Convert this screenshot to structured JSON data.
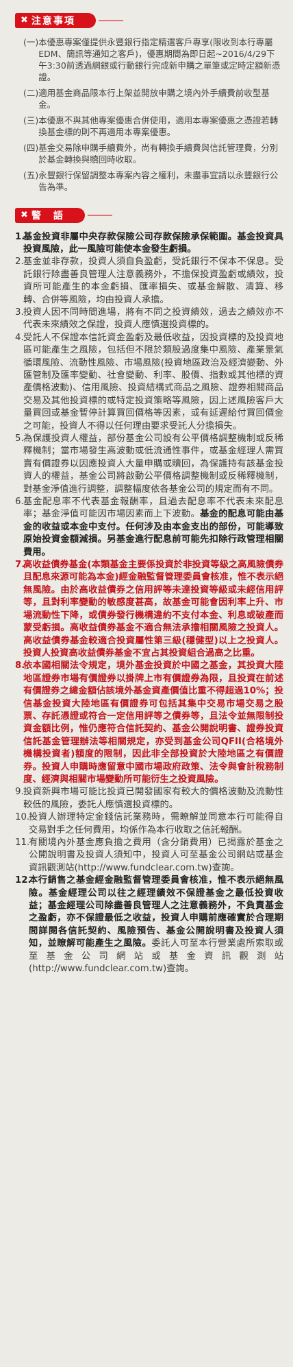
{
  "notes_heading": {
    "icon": "x-mark-icon",
    "label": "注意事項"
  },
  "notes": [
    {
      "num": "(一)",
      "text": "本優惠專案僅提供永豐銀行指定精選客戶專享(限收到本行專屬EDM、簡訊等通知之客戶)，優惠期間為即日起~2016/4/29下午3:30前透過網銀或行動銀行完成新申購之單筆或定時定額新憑證。"
    },
    {
      "num": "(二)",
      "text": "適用基金商品限本行上架並開放申購之境內外手續費前收型基金。"
    },
    {
      "num": "(三)",
      "text": "本優惠不與其他專案優惠合併使用，適用本專案優惠之憑證若轉換基金標的則不再適用本專案優惠。"
    },
    {
      "num": "(四)",
      "text": "基金交易除申購手續費外，尚有轉換手續費與信託管理費，分別於基金轉換與贖回時收取。"
    },
    {
      "num": "(五)",
      "text": "永豐銀行保留調整本專案內容之權利，未盡事宜請以永豐銀行公告為準。"
    }
  ],
  "warnings_heading": {
    "icon": "x-mark-icon",
    "label": "警　語"
  },
  "warnings": [
    {
      "num": "1.",
      "segments": [
        {
          "t": "基金投資非屬中央存款保險公司存款保險承保範圍。基金投資具投資風險，此一風險可能使本金發生虧損。",
          "s": "b"
        }
      ]
    },
    {
      "num": "2.",
      "segments": [
        {
          "t": "基金並非存款，投資人須自負盈虧，受託銀行不保本不保息。受託銀行除盡善良管理人注意義務外，不擔保投資盈虧或績效，投資所可能產生的本金虧損、匯率損失、或基金解散、清算、移轉、合併等風險，均由投資人承擔。",
          "s": ""
        }
      ]
    },
    {
      "num": "3.",
      "segments": [
        {
          "t": "投資人因不同時間進場，將有不同之投資績效，過去之績效亦不代表未來績效之保證，投資人應慎選投資標的。",
          "s": ""
        }
      ]
    },
    {
      "num": "4.",
      "segments": [
        {
          "t": "受託人不保證本信託資金盈虧及最低收益，因投資標的及投資地區可能產生之風險，包括但不限於類股過度集中風險、產業景氣循環風險、流動性風險、市場風險(投資地區政治及經濟變動、外匯管制及匯率變動、社會變動、利率、股價、指數或其他標的資產價格波動)、信用風險、投資結構式商品之風險、證券相關商品交易及其他投資標的或特定投資策略等風險，因上述風險客戶大量買回或基金暫停計算買回價格等因素，或有延遲給付買回價金之可能，投資人不得以任何理由要求受託人分擔損失。",
          "s": ""
        }
      ]
    },
    {
      "num": "5.",
      "segments": [
        {
          "t": "為保護投資人權益，部份基金公司設有公平價格調整機制或反稀釋機制；當市場發生高波動或低流通性事件，或基金經理人需買賣有價證券以因應投資人大量申購或贖回，為保護持有該基金投資人的權益，基金公司將啟動公平價格調整機制或反稀釋機制，對基金淨值進行調整，調整幅度依各基金公司的規定而有不同。",
          "s": ""
        }
      ]
    },
    {
      "num": "6.",
      "segments": [
        {
          "t": "基金配息率不代表基金報酬率，且過去配息率不代表未來配息率；基金淨值可能因市場因素而上下波動。",
          "s": ""
        },
        {
          "t": "基金的配息可能由基金的收益或本金中支付。任何涉及由本金支出的部份，可能導致原始投資金額減損。另基金進行配息前可能先扣除行政管理相關費用。",
          "s": "b"
        }
      ]
    },
    {
      "num": "7.",
      "item": "red",
      "segments": [
        {
          "t": "高收益債券基金(本類基金主要係投資於非投資等級之高風險債券且配息來源可能為本金)經金融監督管理委員會核准，惟不表示絕無風險。由於高收益債券之信用評等未達投資等級或未經信用評等，且對利率變動的敏感度甚高，故基金可能會因利率上升、市場流動性下降，或債券發行機構違約不支付本金、利息或破產而蒙受虧損。高收益債券基金不適合無法承擔相關風險之投資人。高收益債券基金較適合投資屬性第三級(穩健型)以上之投資人。投資人投資高收益債券基金不宜占其投資組合過高之比重。",
          "s": "red"
        }
      ]
    },
    {
      "num": "8.",
      "item": "red",
      "segments": [
        {
          "t": "依本國相關法令規定，境外基金投資於中國之基金，其投資大陸地區證券市場有價證券以掛牌上市有價證券為限，且投資在前述有價證券之總金額佔該境外基金資產價值比重不得超過10%；投信基金投資大陸地區有價證券可包括其集中交易市場交易之股票、存託憑證或符合一定信用評等之債券等，且法令並無限制投資金額比例，惟仍應符合信託契約、基金公開說明書、證券投資信託基金管理辦法等相關規定，亦受到基金公司QFII(合格境外機構投資者)額度的限制，因此非全部投資於大陸地區之有價證券。投資人申購時應留意中國市場政府政策、法令與會計稅務制度、經濟與相關市場變動所可能衍生之投資風險。",
          "s": "red"
        }
      ]
    },
    {
      "num": "9.",
      "segments": [
        {
          "t": "投資新興市場可能比投資已開發國家有較大的價格波動及流動性較低的風險，委託人應慎選投資標的。",
          "s": ""
        }
      ]
    },
    {
      "num": "10.",
      "segments": [
        {
          "t": "投資人辦理特定金錢信託業務時，需瞭解並同意本行可能得自交易對手之任何費用，均係作為本行收取之信託報酬。",
          "s": ""
        }
      ]
    },
    {
      "num": "11.",
      "segments": [
        {
          "t": "有關境內外基金應負擔之費用（含分銷費用）已揭露於基金之公開說明書及投資人須知中，投資人可至基金公司網站或基金資訊觀測站(http://www.fundclear.com.tw)查詢。",
          "s": ""
        }
      ]
    },
    {
      "num": "12.",
      "segments": [
        {
          "t": "本行銷售之基金經金融監督管理委員會核准，惟不表示絕無風險。基金經理公司以往之經理績效不保證基金之最低投資收益；基金經理公司除盡善良管理人之注意義務外，不負責基金之盈虧，亦不保證最低之收益，投資人申購前應確實於合理期間詳閱各信託契約、風險預告、基金公開說明書及投資人須知，並瞭解可能產生之風險。",
          "s": "b"
        },
        {
          "t": "委託人可至本行營業處所索取或至基金公司網站或基金資訊觀測站(http://www.fundclear.com.tw)查詢。",
          "s": ""
        }
      ]
    }
  ]
}
